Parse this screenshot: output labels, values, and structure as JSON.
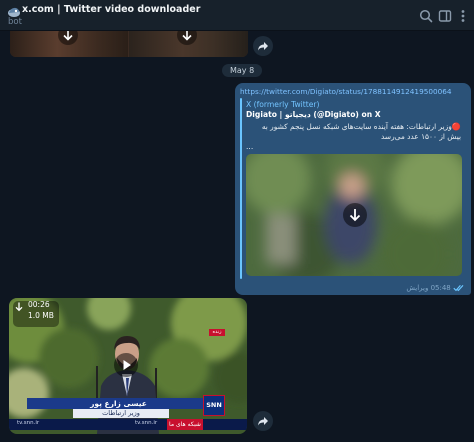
{
  "header": {
    "title": "x.com | Twitter video downloader",
    "subtitle": "bot",
    "icons": [
      "search-icon",
      "columns-icon",
      "more-vertical-icon"
    ]
  },
  "date_separator": "May 8",
  "message": {
    "url": "https://twitter.com/Digiato/status/1788114912419500064",
    "preview": {
      "site": "X (formerly Twitter)",
      "title": "Digiato | دیجیاتو (@Digiato) on X",
      "description": "🔴وزیر ارتباطات: هفته آینده سایت‌های شبکه نسل پنجم کشور به بیش از ۱۵۰۰ عدد می‌رسد",
      "ellipsis": "..."
    },
    "edited_label": "ویرایش",
    "time": "05:48",
    "status": "read"
  },
  "video": {
    "duration": "00:26",
    "size": "1.0 MB",
    "lower_third_name": "عیسی زارع پور",
    "lower_third_role": "وزیر ارتباطات",
    "channel": "SNN",
    "ticker_site1": "tv.snn.ir",
    "ticker_site2": "tv.snn.ir",
    "ticker_label": "شبکه های ما",
    "tag": "زنده"
  },
  "colors": {
    "app_bg": "#0e1621",
    "header_bg": "#17212b",
    "outgoing_bubble": "#2b5278",
    "link": "#7fc2ff",
    "accent": "#6ac5ff"
  }
}
